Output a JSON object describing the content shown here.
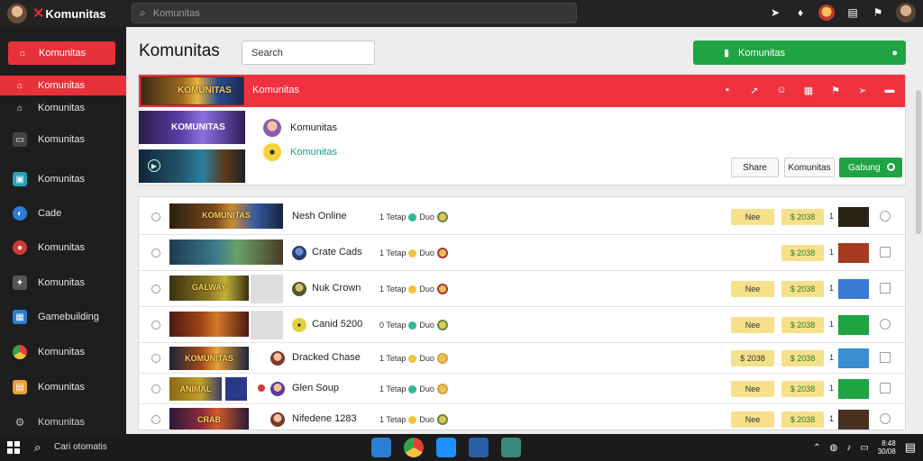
{
  "topbar": {
    "logo_text": "Komunitas",
    "search_placeholder": "Komunitas",
    "icons": [
      "avatar",
      "cursor-icon",
      "bell-icon",
      "palette-icon",
      "document-icon",
      "flag-icon",
      "profile-avatar"
    ]
  },
  "sidebar": {
    "primary_label": "Komunitas",
    "items": [
      {
        "label": "Komunitas",
        "icon": "home-icon",
        "color": "#ffffff",
        "active": true
      },
      {
        "label": "Komunitas",
        "icon": "home-icon",
        "color": "#e6e6e6",
        "active": false
      },
      {
        "label": "Komunitas",
        "icon": "chat-icon",
        "color": "#e6e6e6",
        "active": false
      },
      {
        "label": "Komunitas",
        "icon": "games-icon",
        "color": "#22a3b8",
        "active": false
      },
      {
        "label": "Cade",
        "icon": "globe-icon",
        "color": "#2b7ad6",
        "active": false
      },
      {
        "label": "Komunitas",
        "icon": "group-icon",
        "color": "#d13a3a",
        "active": false
      },
      {
        "label": "Komunitas",
        "icon": "controller-icon",
        "color": "#8a8a8a",
        "active": false
      },
      {
        "label": "Gamebuilding",
        "icon": "grid-icon",
        "color": "#2a7fd0",
        "active": false
      },
      {
        "label": "Komunitas",
        "icon": "chrome-icon",
        "color": "#e6a13a",
        "active": false
      },
      {
        "label": "Komunitas",
        "icon": "store-icon",
        "color": "#e6a13a",
        "active": false
      }
    ],
    "bottom_label": "Komunitas"
  },
  "main": {
    "title": "Komunitas",
    "search_text": "Search",
    "create_label": "Komunitas",
    "banner_title": "Komunitas",
    "banner_thumb_text": "KOMUNITAS",
    "panel_thumb_text": "KOMUNITAS",
    "message_text": "Komunitas",
    "message_link": "Komunitas",
    "buttons": {
      "first": "Share",
      "second": "Komunitas",
      "primary": "Gabung"
    }
  },
  "rows": [
    {
      "thumb_text": "KOMUNITAS",
      "name": "Nesh Online",
      "stat": "1 Tetap",
      "badge": "Duo",
      "pill_left": "Nee",
      "pill_right": "$ 2038",
      "num": "1",
      "small_color": "#2c2218",
      "end": "round"
    },
    {
      "thumb_text": "",
      "name": "Crate Cads",
      "stat": "1 Tetap",
      "badge": "Duo",
      "pill_left": "",
      "pill_right": "$ 2038",
      "num": "1",
      "small_color": "#a43b22",
      "end": "square"
    },
    {
      "thumb_text": "GALWAY",
      "name": "Nuk Crown",
      "stat": "1 Tetap",
      "badge": "Duo",
      "pill_left": "Nee",
      "pill_right": "$ 2038",
      "num": "1",
      "small_color": "#3a7ad0",
      "end": "square"
    },
    {
      "thumb_text": "",
      "name": "Canid 5200",
      "stat": "0 Tetap",
      "badge": "Duo",
      "pill_left": "Nee",
      "pill_right": "$ 2038",
      "num": "1",
      "small_color": "#20a343",
      "end": "round"
    },
    {
      "thumb_text": "KOMUNITAS",
      "name": "Dracked Chase",
      "stat": "1 Tetap",
      "badge": "Duo",
      "pill_left": "$ 2038",
      "pill_right": "$ 2038",
      "num": "1",
      "small_color": "#3a8fd0",
      "end": "square"
    },
    {
      "thumb_text": "ANIMAL",
      "name": "Glen Soup",
      "stat": "1 Tetap",
      "badge": "Duo",
      "pill_left": "Nee",
      "pill_right": "$ 2038",
      "num": "1",
      "small_color": "#20a343",
      "end": "square"
    },
    {
      "thumb_text": "CRAB",
      "name": "Nifedene 1283",
      "stat": "1 Tetap",
      "badge": "Duo",
      "pill_left": "Nee",
      "pill_right": "$ 2038",
      "num": "1",
      "small_color": "#4a3020",
      "end": "round"
    }
  ],
  "taskbar": {
    "search_text": "Cari otomatis",
    "clock_time": "8:48",
    "clock_date": "30/08"
  }
}
